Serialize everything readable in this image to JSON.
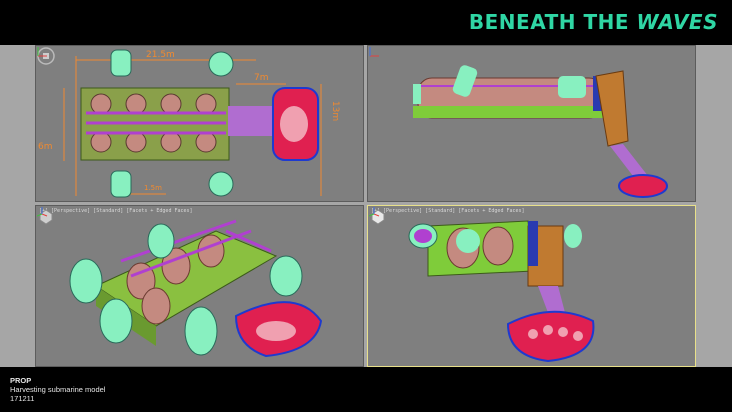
{
  "header": {
    "brand_main": "BENEATH THE",
    "brand_italic": "WAVES",
    "accent_color": "#2fd6a4"
  },
  "viewports": {
    "top": {
      "label": "",
      "dim_width": "21.5m",
      "dim_arm": "7m",
      "dim_height": "6m",
      "dim_right": "13m",
      "dim_small": "1.5m"
    },
    "front": {
      "label": ""
    },
    "persp_a": {
      "label": "[+] [Perspective] [Standard] [Facets + Edged Faces]"
    },
    "persp_b": {
      "label": "[+] [Perspective] [Standard] [Facets + Edged Faces]"
    }
  },
  "caption": {
    "category": "PROP",
    "title": "Harvesting submarine model",
    "code": "171211"
  },
  "icons": [
    "view-cube-icon",
    "axis-tripod-icon"
  ]
}
